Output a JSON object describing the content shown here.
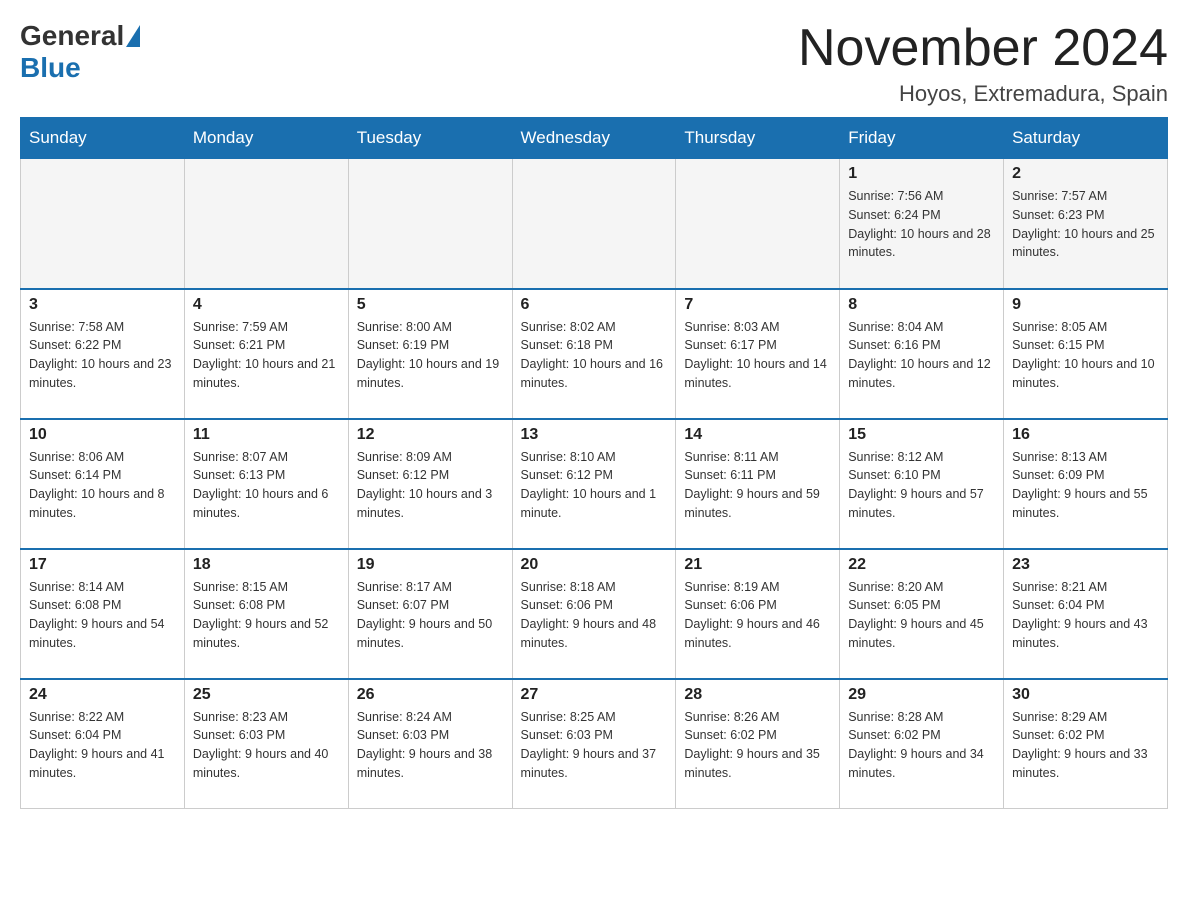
{
  "logo": {
    "general": "General",
    "blue": "Blue"
  },
  "title": "November 2024",
  "location": "Hoyos, Extremadura, Spain",
  "days_of_week": [
    "Sunday",
    "Monday",
    "Tuesday",
    "Wednesday",
    "Thursday",
    "Friday",
    "Saturday"
  ],
  "weeks": [
    [
      {
        "day": "",
        "sunrise": "",
        "sunset": "",
        "daylight": ""
      },
      {
        "day": "",
        "sunrise": "",
        "sunset": "",
        "daylight": ""
      },
      {
        "day": "",
        "sunrise": "",
        "sunset": "",
        "daylight": ""
      },
      {
        "day": "",
        "sunrise": "",
        "sunset": "",
        "daylight": ""
      },
      {
        "day": "",
        "sunrise": "",
        "sunset": "",
        "daylight": ""
      },
      {
        "day": "1",
        "sunrise": "Sunrise: 7:56 AM",
        "sunset": "Sunset: 6:24 PM",
        "daylight": "Daylight: 10 hours and 28 minutes."
      },
      {
        "day": "2",
        "sunrise": "Sunrise: 7:57 AM",
        "sunset": "Sunset: 6:23 PM",
        "daylight": "Daylight: 10 hours and 25 minutes."
      }
    ],
    [
      {
        "day": "3",
        "sunrise": "Sunrise: 7:58 AM",
        "sunset": "Sunset: 6:22 PM",
        "daylight": "Daylight: 10 hours and 23 minutes."
      },
      {
        "day": "4",
        "sunrise": "Sunrise: 7:59 AM",
        "sunset": "Sunset: 6:21 PM",
        "daylight": "Daylight: 10 hours and 21 minutes."
      },
      {
        "day": "5",
        "sunrise": "Sunrise: 8:00 AM",
        "sunset": "Sunset: 6:19 PM",
        "daylight": "Daylight: 10 hours and 19 minutes."
      },
      {
        "day": "6",
        "sunrise": "Sunrise: 8:02 AM",
        "sunset": "Sunset: 6:18 PM",
        "daylight": "Daylight: 10 hours and 16 minutes."
      },
      {
        "day": "7",
        "sunrise": "Sunrise: 8:03 AM",
        "sunset": "Sunset: 6:17 PM",
        "daylight": "Daylight: 10 hours and 14 minutes."
      },
      {
        "day": "8",
        "sunrise": "Sunrise: 8:04 AM",
        "sunset": "Sunset: 6:16 PM",
        "daylight": "Daylight: 10 hours and 12 minutes."
      },
      {
        "day": "9",
        "sunrise": "Sunrise: 8:05 AM",
        "sunset": "Sunset: 6:15 PM",
        "daylight": "Daylight: 10 hours and 10 minutes."
      }
    ],
    [
      {
        "day": "10",
        "sunrise": "Sunrise: 8:06 AM",
        "sunset": "Sunset: 6:14 PM",
        "daylight": "Daylight: 10 hours and 8 minutes."
      },
      {
        "day": "11",
        "sunrise": "Sunrise: 8:07 AM",
        "sunset": "Sunset: 6:13 PM",
        "daylight": "Daylight: 10 hours and 6 minutes."
      },
      {
        "day": "12",
        "sunrise": "Sunrise: 8:09 AM",
        "sunset": "Sunset: 6:12 PM",
        "daylight": "Daylight: 10 hours and 3 minutes."
      },
      {
        "day": "13",
        "sunrise": "Sunrise: 8:10 AM",
        "sunset": "Sunset: 6:12 PM",
        "daylight": "Daylight: 10 hours and 1 minute."
      },
      {
        "day": "14",
        "sunrise": "Sunrise: 8:11 AM",
        "sunset": "Sunset: 6:11 PM",
        "daylight": "Daylight: 9 hours and 59 minutes."
      },
      {
        "day": "15",
        "sunrise": "Sunrise: 8:12 AM",
        "sunset": "Sunset: 6:10 PM",
        "daylight": "Daylight: 9 hours and 57 minutes."
      },
      {
        "day": "16",
        "sunrise": "Sunrise: 8:13 AM",
        "sunset": "Sunset: 6:09 PM",
        "daylight": "Daylight: 9 hours and 55 minutes."
      }
    ],
    [
      {
        "day": "17",
        "sunrise": "Sunrise: 8:14 AM",
        "sunset": "Sunset: 6:08 PM",
        "daylight": "Daylight: 9 hours and 54 minutes."
      },
      {
        "day": "18",
        "sunrise": "Sunrise: 8:15 AM",
        "sunset": "Sunset: 6:08 PM",
        "daylight": "Daylight: 9 hours and 52 minutes."
      },
      {
        "day": "19",
        "sunrise": "Sunrise: 8:17 AM",
        "sunset": "Sunset: 6:07 PM",
        "daylight": "Daylight: 9 hours and 50 minutes."
      },
      {
        "day": "20",
        "sunrise": "Sunrise: 8:18 AM",
        "sunset": "Sunset: 6:06 PM",
        "daylight": "Daylight: 9 hours and 48 minutes."
      },
      {
        "day": "21",
        "sunrise": "Sunrise: 8:19 AM",
        "sunset": "Sunset: 6:06 PM",
        "daylight": "Daylight: 9 hours and 46 minutes."
      },
      {
        "day": "22",
        "sunrise": "Sunrise: 8:20 AM",
        "sunset": "Sunset: 6:05 PM",
        "daylight": "Daylight: 9 hours and 45 minutes."
      },
      {
        "day": "23",
        "sunrise": "Sunrise: 8:21 AM",
        "sunset": "Sunset: 6:04 PM",
        "daylight": "Daylight: 9 hours and 43 minutes."
      }
    ],
    [
      {
        "day": "24",
        "sunrise": "Sunrise: 8:22 AM",
        "sunset": "Sunset: 6:04 PM",
        "daylight": "Daylight: 9 hours and 41 minutes."
      },
      {
        "day": "25",
        "sunrise": "Sunrise: 8:23 AM",
        "sunset": "Sunset: 6:03 PM",
        "daylight": "Daylight: 9 hours and 40 minutes."
      },
      {
        "day": "26",
        "sunrise": "Sunrise: 8:24 AM",
        "sunset": "Sunset: 6:03 PM",
        "daylight": "Daylight: 9 hours and 38 minutes."
      },
      {
        "day": "27",
        "sunrise": "Sunrise: 8:25 AM",
        "sunset": "Sunset: 6:03 PM",
        "daylight": "Daylight: 9 hours and 37 minutes."
      },
      {
        "day": "28",
        "sunrise": "Sunrise: 8:26 AM",
        "sunset": "Sunset: 6:02 PM",
        "daylight": "Daylight: 9 hours and 35 minutes."
      },
      {
        "day": "29",
        "sunrise": "Sunrise: 8:28 AM",
        "sunset": "Sunset: 6:02 PM",
        "daylight": "Daylight: 9 hours and 34 minutes."
      },
      {
        "day": "30",
        "sunrise": "Sunrise: 8:29 AM",
        "sunset": "Sunset: 6:02 PM",
        "daylight": "Daylight: 9 hours and 33 minutes."
      }
    ]
  ]
}
